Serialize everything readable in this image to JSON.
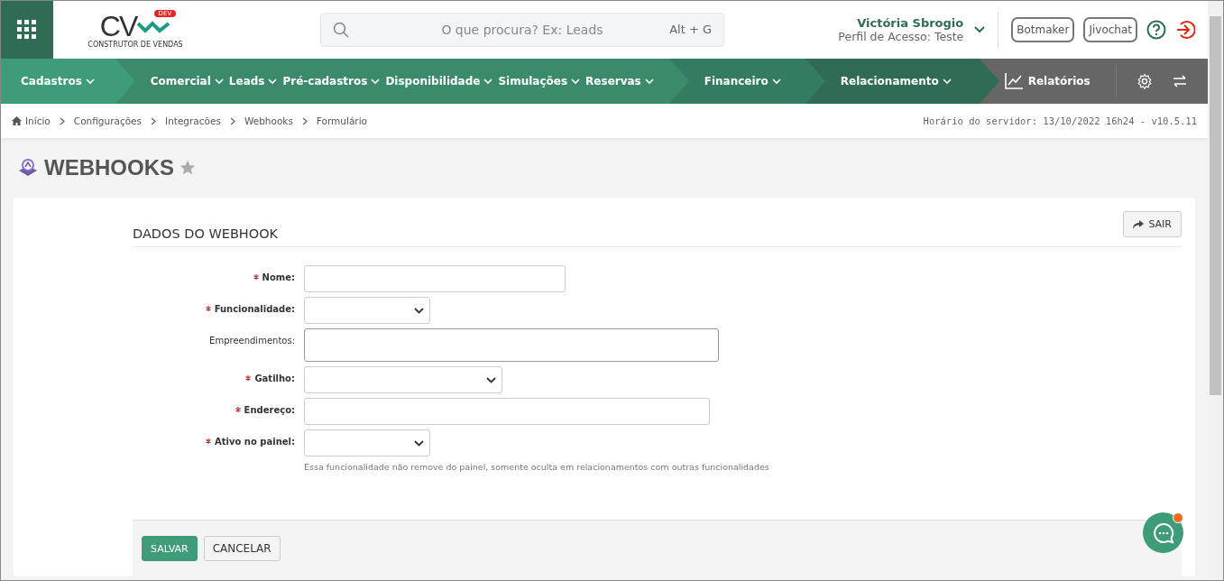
{
  "header": {
    "logo": {
      "text": "CV",
      "badge": "DEV",
      "tagline": "CONSTRUTOR DE VENDAS"
    },
    "search": {
      "placeholder": "O que procura? Ex: Leads",
      "shortcut": "Alt + G"
    },
    "user": {
      "name": "Victória Sbrogio",
      "profile": "Perfil de Acesso: Teste"
    },
    "buttons": [
      "Botmaker",
      "Jivochat"
    ]
  },
  "nav": {
    "groups": [
      {
        "items": [
          "Cadastros"
        ]
      },
      {
        "items": [
          "Comercial",
          "Leads",
          "Pré-cadastros",
          "Disponibilidade",
          "Simulações",
          "Reservas"
        ]
      },
      {
        "items": [
          "Financeiro"
        ]
      },
      {
        "items": [
          "Relacionamento"
        ]
      }
    ],
    "reports": "Relatórios"
  },
  "breadcrumb": [
    "Início",
    "Configurações",
    "Integracões",
    "Webhooks",
    "Formulário"
  ],
  "server_time": "Horário do servidor: 13/10/2022 16h24 - v10.5.11",
  "page": {
    "title": "WEBHOOKS",
    "favorite": false
  },
  "exit_button": "SAIR",
  "section_title": "DADOS DO WEBHOOK",
  "fields": [
    {
      "label": "Nome:",
      "kind": "text",
      "required": true
    },
    {
      "label": "Funcionalidade:",
      "kind": "select",
      "required": true
    },
    {
      "label": "Empreendimentos:",
      "kind": "textarea",
      "required": false
    },
    {
      "label": "Gatilho:",
      "kind": "select",
      "required": true
    },
    {
      "label": "Endereço:",
      "kind": "text",
      "required": true
    },
    {
      "label": "Ativo no painel:",
      "kind": "select",
      "required": true,
      "help": "Essa funcionalidade não remove do painel, somente oculta em relacionamentos com outras funcionalidades"
    }
  ],
  "actions": [
    {
      "label": "SALVAR",
      "kind": "primary"
    },
    {
      "label": "CANCELAR",
      "kind": "default"
    }
  ],
  "chat": {
    "unread": true
  }
}
